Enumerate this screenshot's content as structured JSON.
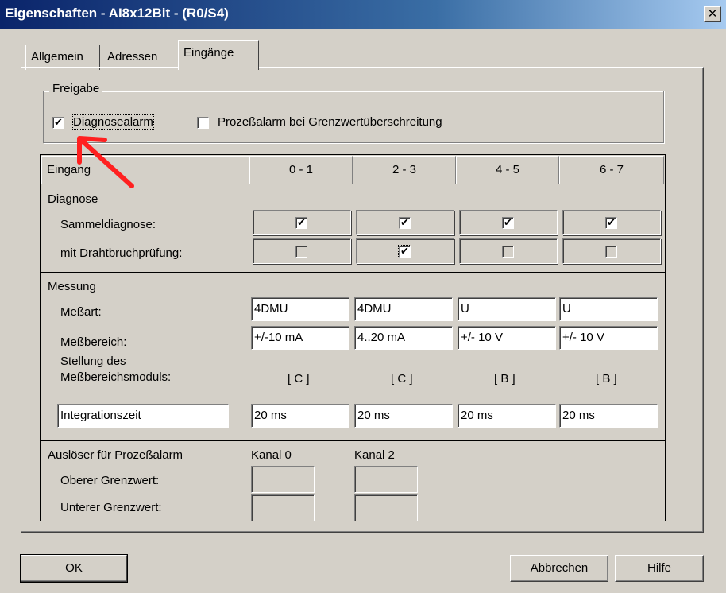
{
  "window": {
    "title": "Eigenschaften - AI8x12Bit - (R0/S4)",
    "close_glyph": "✕"
  },
  "tabs": [
    {
      "label": "Allgemein"
    },
    {
      "label": "Adressen"
    },
    {
      "label": "Eingänge"
    }
  ],
  "freigabe": {
    "legend": "Freigabe",
    "diagnosealarm": {
      "label": "Diagnosealarm",
      "checked": true
    },
    "prozessalarm": {
      "label": "Prozeßalarm bei Grenzwertüberschreitung",
      "checked": false
    }
  },
  "table": {
    "header": [
      "Eingang",
      "0 - 1",
      "2 - 3",
      "4 - 5",
      "6 - 7"
    ],
    "diagnose": {
      "title": "Diagnose",
      "sammel_label": "Sammeldiagnose:",
      "sammel": [
        true,
        true,
        true,
        true
      ],
      "draht_label": "mit Drahtbruchprüfung:",
      "draht": [
        false,
        true,
        false,
        false
      ]
    },
    "messung": {
      "title": "Messung",
      "messart_label": "Meßart:",
      "messart": [
        "4DMU",
        "4DMU",
        "U",
        "U"
      ],
      "messbereich_label": "Meßbereich:",
      "messbereich": [
        "+/-10 mA",
        "4..20 mA",
        "+/- 10 V",
        "+/- 10 V"
      ],
      "stellung_label_1": "Stellung des",
      "stellung_label_2": "Meßbereichsmoduls:",
      "stellung": [
        "[ C ]",
        "[ C ]",
        "[ B ]",
        "[ B ]"
      ],
      "integration_select": "Integrationszeit",
      "integration": [
        "20 ms",
        "20 ms",
        "20 ms",
        "20 ms"
      ]
    },
    "ausloeser": {
      "title": "Auslöser für Prozeßalarm",
      "kanal_0": "Kanal 0",
      "kanal_2": "Kanal 2",
      "oberer_label": "Oberer Grenzwert:",
      "unterer_label": "Unterer Grenzwert:"
    }
  },
  "buttons": {
    "ok": "OK",
    "cancel": "Abbrechen",
    "help": "Hilfe"
  },
  "colors": {
    "titlebar_start": "#0a246a",
    "dialog_bg": "#d4d0c8",
    "annotation_arrow": "#ff2020"
  }
}
